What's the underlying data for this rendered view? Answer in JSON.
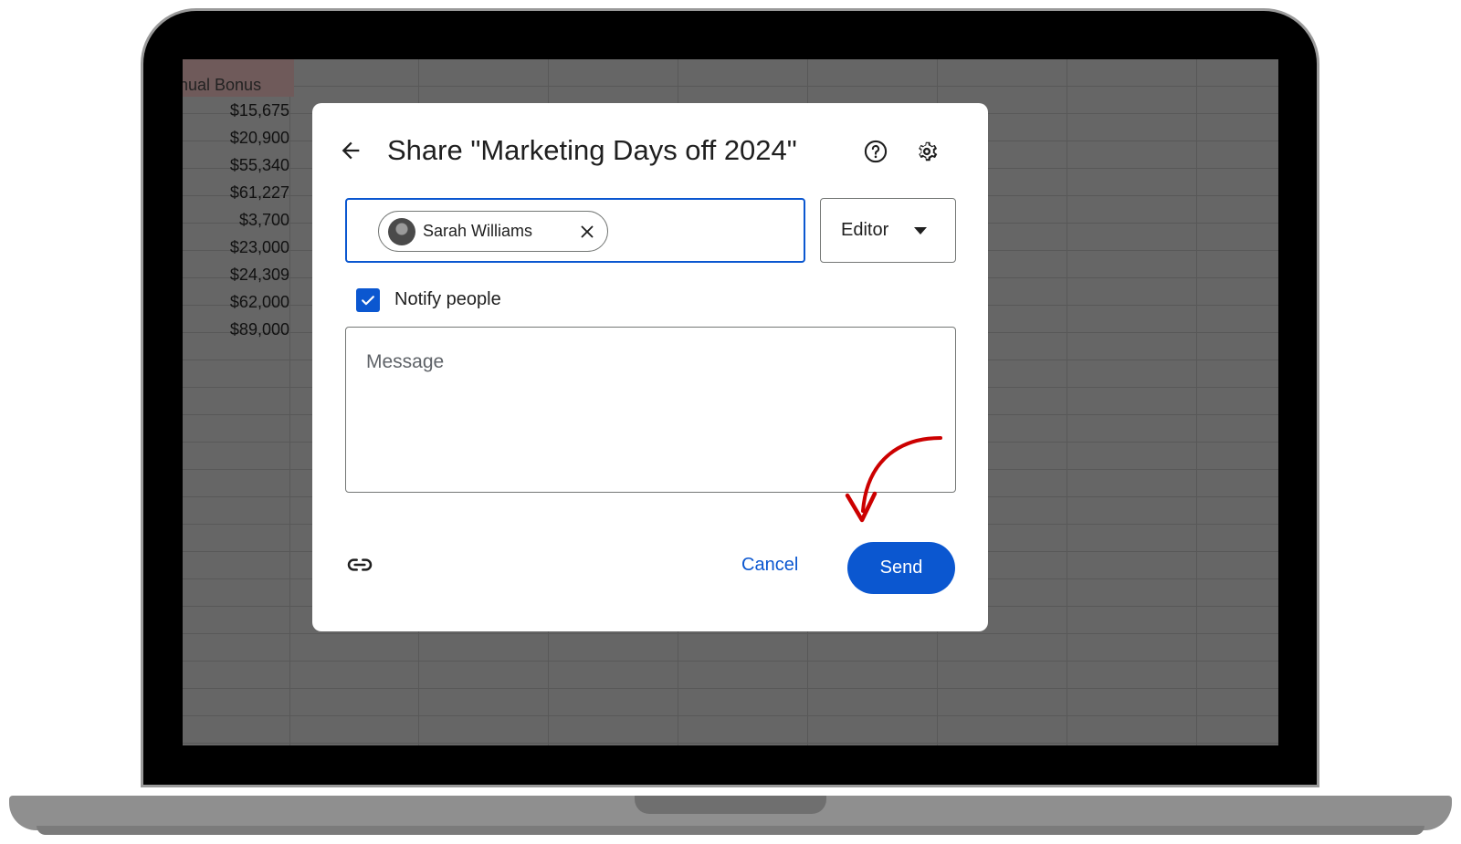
{
  "spreadsheet": {
    "header": "nual Bonus",
    "values": [
      "$15,675",
      "$20,900",
      "$55,340",
      "$61,227",
      "$3,700",
      "$23,000",
      "$24,309",
      "$62,000",
      "$89,000"
    ]
  },
  "dialog": {
    "title": "Share \"Marketing Days off 2024\"",
    "recipients": [
      {
        "name": "Sarah Williams"
      }
    ],
    "role": "Editor",
    "notify_label": "Notify people",
    "notify_checked": true,
    "message_placeholder": "Message",
    "cancel_label": "Cancel",
    "send_label": "Send"
  },
  "icons": {
    "back": "arrow-left-icon",
    "help": "help-circle-icon",
    "settings": "gear-icon",
    "remove": "close-icon",
    "dropdown": "caret-down-icon",
    "copy_link": "link-icon"
  },
  "colors": {
    "accent": "#0b57d0",
    "annotation": "#cc0000",
    "overlay": "#666666"
  }
}
